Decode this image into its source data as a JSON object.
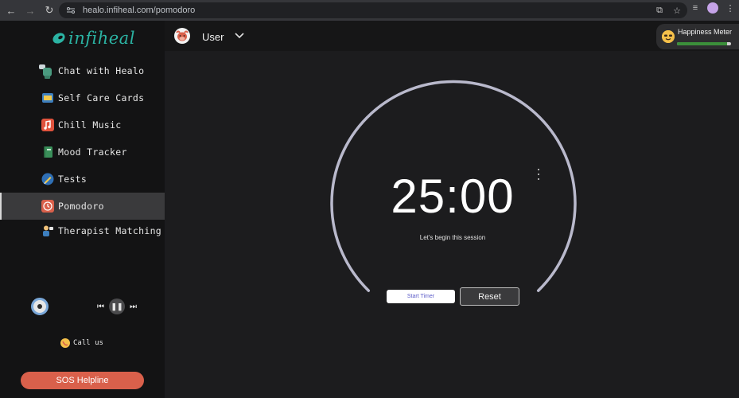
{
  "browser": {
    "url": "healo.infiheal.com/pomodoro"
  },
  "app": {
    "logo_text": "infiheal",
    "brand_color": "#2bb3a3"
  },
  "sidebar": {
    "items": [
      {
        "label": "Chat with Healo",
        "icon": "robot-icon"
      },
      {
        "label": "Self Care Cards",
        "icon": "cards-icon"
      },
      {
        "label": "Chill Music",
        "icon": "music-note-icon"
      },
      {
        "label": "Mood Tracker",
        "icon": "notebook-icon"
      },
      {
        "label": "Tests",
        "icon": "pencil-icon"
      },
      {
        "label": "Pomodoro",
        "icon": "clock-icon",
        "active": true
      },
      {
        "label": "Therapist Matching",
        "icon": "person-icon"
      }
    ],
    "call_label": "Call us",
    "sos_label": "SOS Helpline",
    "sos_color": "#d9604b"
  },
  "header": {
    "user_name": "User",
    "happiness_label": "Happiness Meter",
    "happiness_level": 0.92
  },
  "timer": {
    "time": "25:00",
    "subtitle": "Let's begin this session",
    "start_label": "Start Timer",
    "reset_label": "Reset",
    "ring_color": "#b9b9cc"
  }
}
